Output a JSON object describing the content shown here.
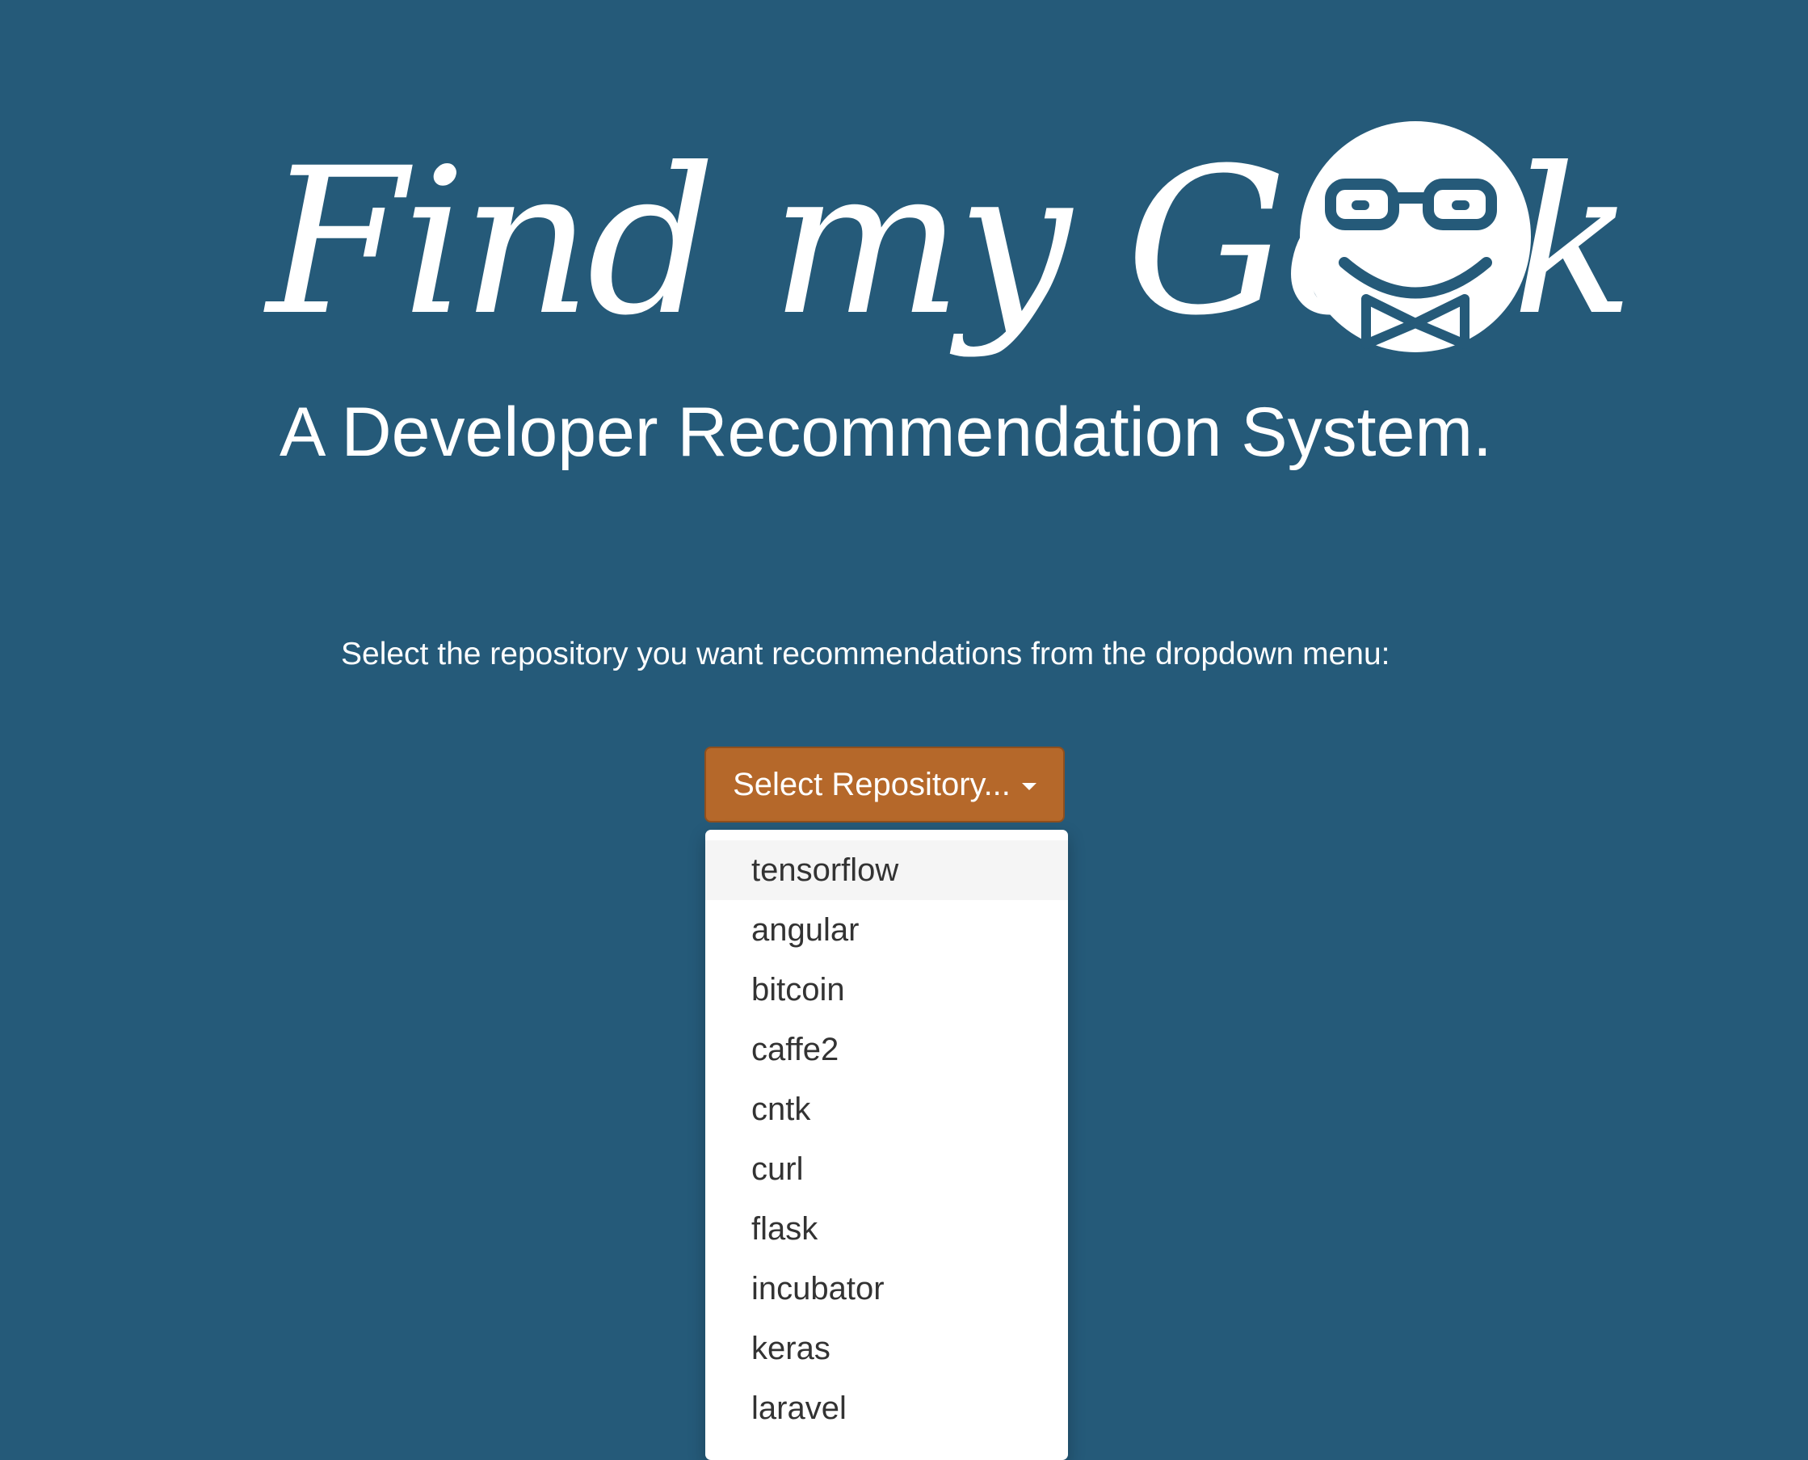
{
  "header": {
    "title": "Find my Geek",
    "logo_icon": "smiling-geek-icon",
    "subtitle": "A Developer Recommendation System."
  },
  "main": {
    "instructions": "Select the repository you want recommendations from the dropdown menu:",
    "select_label": "Select Repository...",
    "select_icon": "caret-down-icon",
    "repositories": [
      "tensorflow",
      "angular",
      "bitcoin",
      "caffe2",
      "cntk",
      "curl",
      "flask",
      "incubator",
      "keras",
      "laravel"
    ],
    "highlighted_item": "tensorflow"
  },
  "colors": {
    "background": "#255a79",
    "button": "#b5682a",
    "menu_background": "#ffffff",
    "menu_highlight": "#f5f5f5",
    "menu_text": "#333333"
  }
}
